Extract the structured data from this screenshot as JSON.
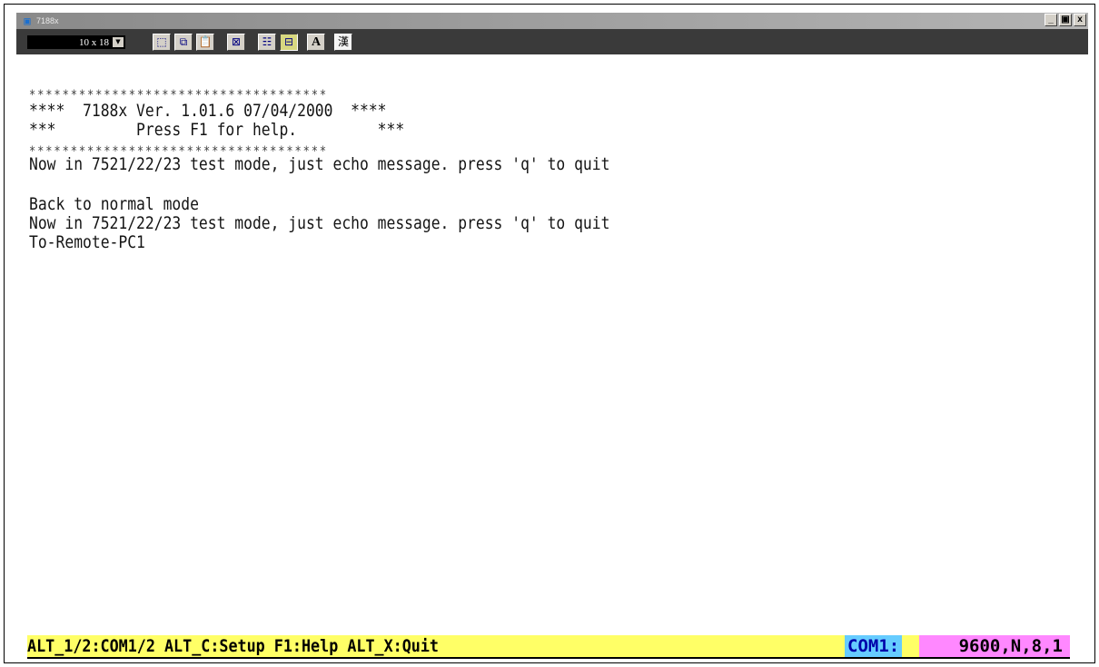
{
  "window": {
    "title": "7188x",
    "app_icon": "terminal-app-icon",
    "controls": {
      "minimize": "_",
      "maximize": "▣",
      "close": "x"
    }
  },
  "toolbar": {
    "font_size": "10 x 18",
    "buttons": [
      {
        "icon": "mark-icon",
        "glyph": "⬚"
      },
      {
        "icon": "copy-icon",
        "glyph": "⧉"
      },
      {
        "icon": "paste-icon",
        "glyph": "📋"
      },
      {
        "icon": "fullscreen-icon",
        "glyph": "⊠"
      },
      {
        "icon": "properties-icon",
        "glyph": "☷"
      },
      {
        "icon": "background-icon",
        "glyph": "⊟"
      },
      {
        "icon": "font-icon",
        "glyph": "A"
      },
      {
        "icon": "kanji-icon",
        "glyph": "漢"
      }
    ]
  },
  "console": {
    "lines": [
      "************************************",
      "****  7188x Ver. 1.01.6 07/04/2000  ****",
      "***         Press F1 for help.         ***",
      "************************************",
      "Now in 7521/22/23 test mode, just echo message. press 'q' to quit",
      "",
      "Back to normal mode",
      "Now in 7521/22/23 test mode, just echo message. press 'q' to quit",
      "To-Remote-PC1"
    ]
  },
  "statusbar": {
    "help": "ALT_1/2:COM1/2 ALT_C:Setup F1:Help ALT_X:Quit",
    "port": "COM1:",
    "settings": "9600,N,8,1"
  },
  "colors": {
    "status_bg": "#ffff66",
    "port_bg": "#66ccff",
    "settings_bg": "#ff88ff",
    "toolbar_bg": "#3a3a3a"
  }
}
